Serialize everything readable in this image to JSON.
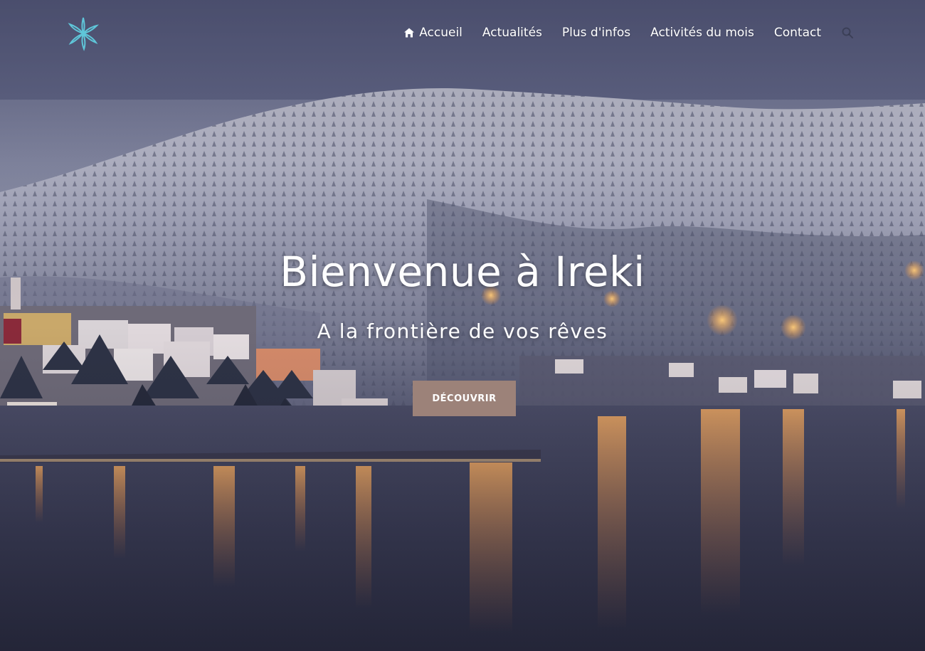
{
  "nav": {
    "items": [
      {
        "label": "Accueil",
        "icon": "home-icon"
      },
      {
        "label": "Actualités"
      },
      {
        "label": "Plus d'infos"
      },
      {
        "label": "Activités du mois"
      },
      {
        "label": "Contact"
      }
    ],
    "search_icon": "search-icon"
  },
  "logo": {
    "icon": "star-flower-logo",
    "color": "#5fc6d9"
  },
  "hero": {
    "title": "Bienvenue à Ireki",
    "subtitle": "A la frontière de vos rêves",
    "cta_label": "DÉCOUVRIR",
    "cta_color": "#9c8279",
    "background": "snowy-lakeside-town-at-dusk"
  }
}
